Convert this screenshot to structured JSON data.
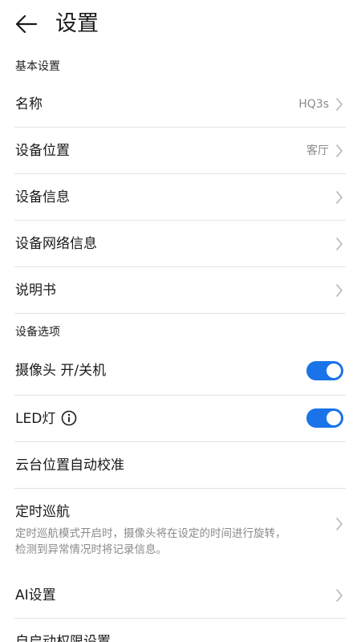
{
  "header": {
    "title": "设置"
  },
  "sections": {
    "basic_title": "基本设置",
    "options_title": "设备选项"
  },
  "basic_items": [
    {
      "label": "名称",
      "value": "HQ3s"
    },
    {
      "label": "设备位置",
      "value": "客厅"
    },
    {
      "label": "设备信息"
    },
    {
      "label": "设备网络信息"
    },
    {
      "label": "说明书"
    }
  ],
  "option_items": {
    "camera_power": {
      "label": "摄像头 开/关机",
      "enabled": true
    },
    "led": {
      "label": "LED灯",
      "enabled": true
    },
    "ptz_calibration": {
      "label": "云台位置自动校准"
    },
    "patrol": {
      "label": "定时巡航",
      "description_line1": "定时巡航模式开启时，摄像头将在设定的时间进行旋转，",
      "description_line2": "检测到异常情况时将记录信息。"
    },
    "ai": {
      "label": "AI设置"
    },
    "autostart": {
      "label": "自启动权限设置"
    }
  },
  "colors": {
    "accent": "#1a73e8",
    "divider": "#e3e3e3",
    "secondary_text": "#8a8a8a"
  }
}
